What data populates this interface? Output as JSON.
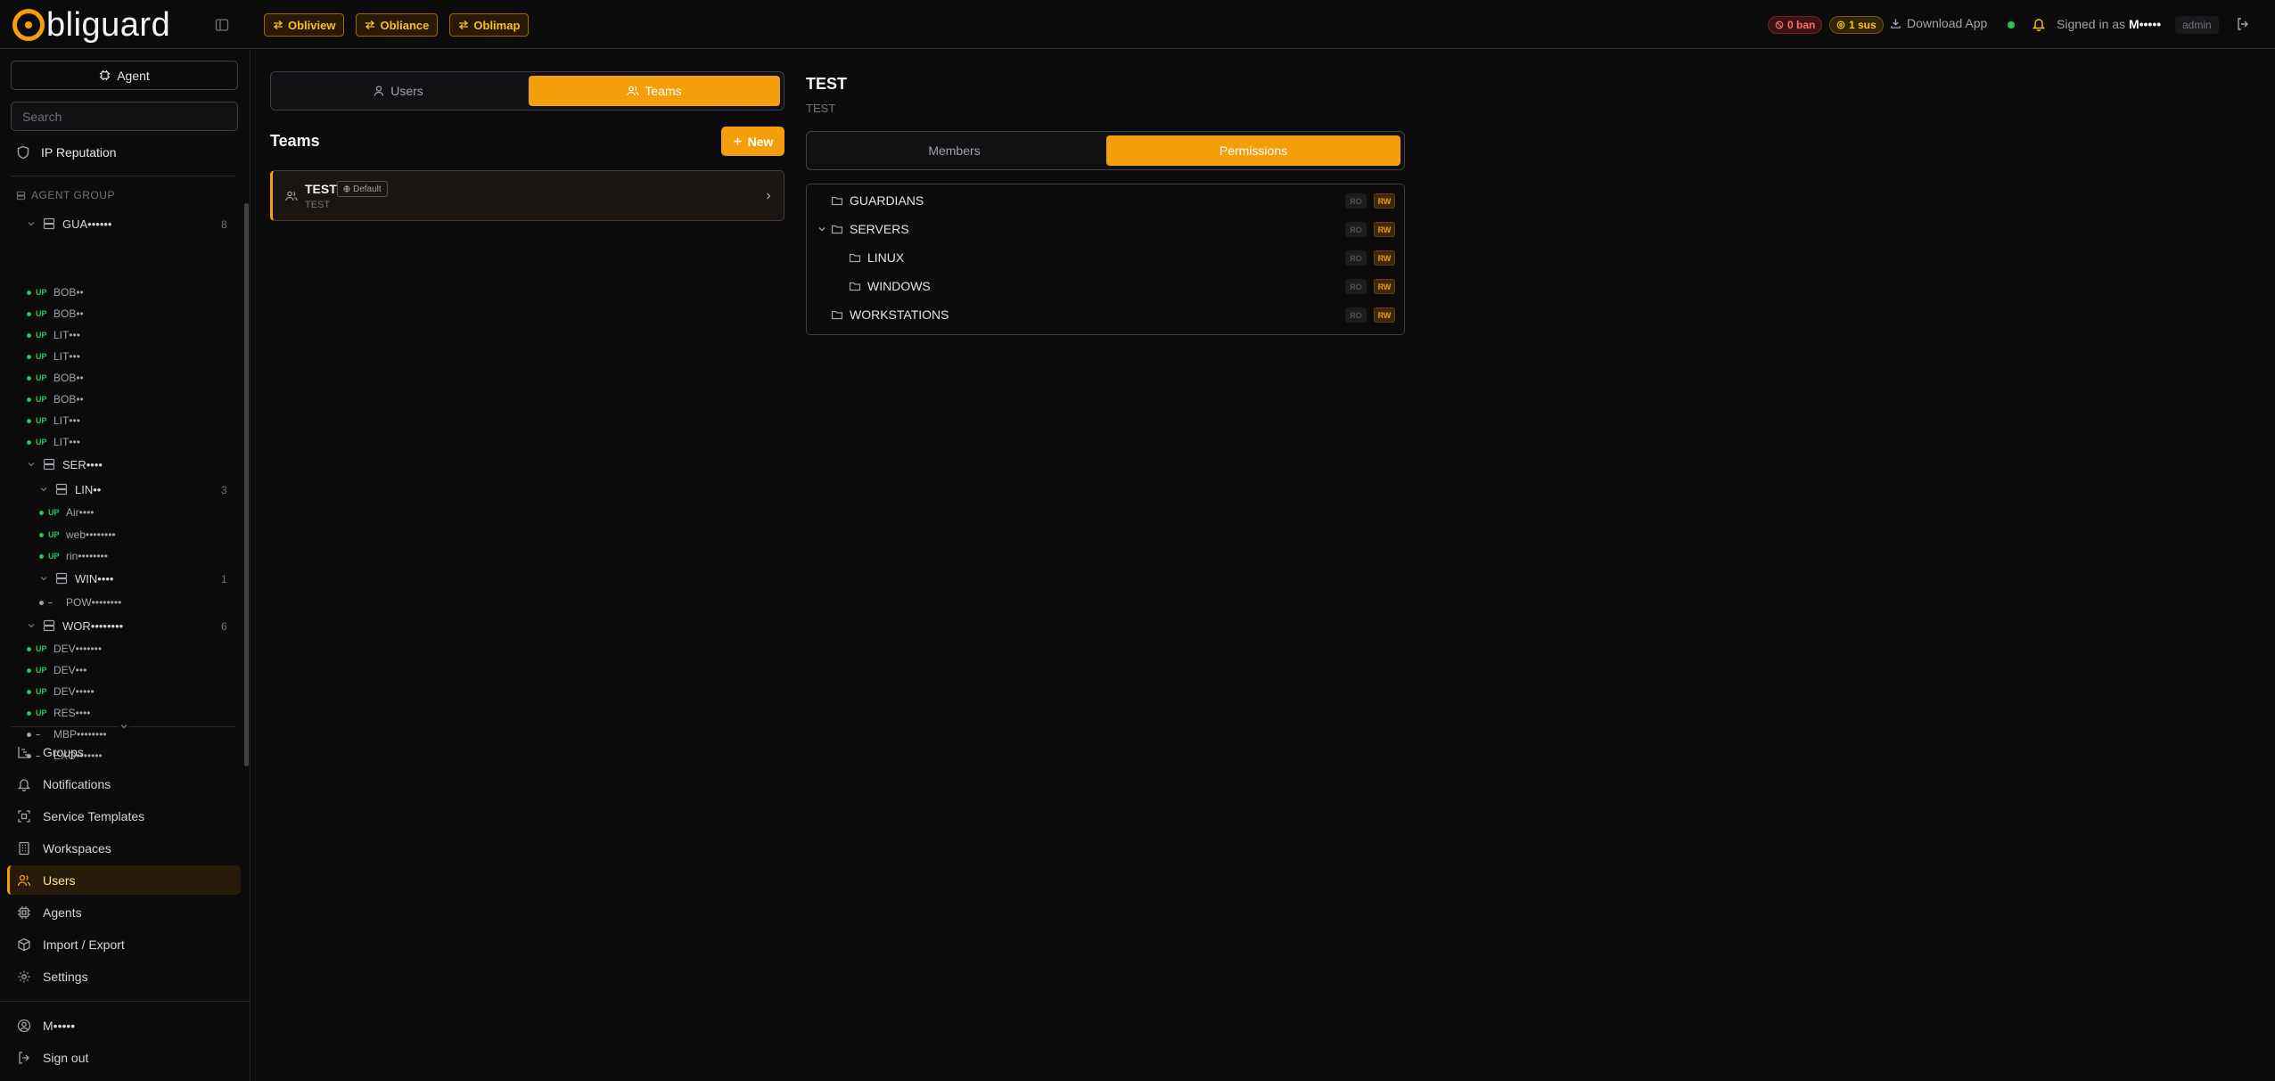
{
  "brand": {
    "logo_letter": "O",
    "logo_text": "bliguard"
  },
  "header": {
    "app_links": [
      {
        "label": "Obliview",
        "icon": "switch-icon"
      },
      {
        "label": "Obliance",
        "icon": "switch-icon"
      },
      {
        "label": "Oblimap",
        "icon": "switch-icon"
      }
    ],
    "ban_badge": "0 ban",
    "sus_badge": "1 sus",
    "download_label": "Download App",
    "signed_in_prefix": "Signed in as",
    "username": "M•••••",
    "role": "admin",
    "colors": {
      "accent": "#f59e0b",
      "online": "#22c55e",
      "ban": "#f87171",
      "sus": "#facc15"
    }
  },
  "sidebar": {
    "agent_button": "Agent",
    "search_placeholder": "Search",
    "ip_reputation": "IP Reputation",
    "agent_group_heading": "AGENT GROUP",
    "tree": {
      "guardians": {
        "name": "GUA••••••",
        "count": "8"
      },
      "guardian_agents": [
        {
          "status": "UP",
          "name": "BOB••"
        },
        {
          "status": "UP",
          "name": "BOB••"
        },
        {
          "status": "UP",
          "name": "LIT•••"
        },
        {
          "status": "UP",
          "name": "LIT•••"
        },
        {
          "status": "UP",
          "name": "BOB••"
        },
        {
          "status": "UP",
          "name": "BOB••"
        },
        {
          "status": "UP",
          "name": "LIT•••"
        },
        {
          "status": "UP",
          "name": "LIT•••"
        }
      ],
      "servers": {
        "name": "SER••••"
      },
      "linux": {
        "name": "LIN••",
        "count": "3"
      },
      "linux_agents": [
        {
          "status": "UP",
          "name": "Air••••"
        },
        {
          "status": "UP",
          "name": "web••••••••"
        },
        {
          "status": "UP",
          "name": "rin••••••••"
        }
      ],
      "windows": {
        "name": "WIN••••",
        "count": "1"
      },
      "windows_agents": [
        {
          "status": "–",
          "name": "POW••••••••"
        }
      ],
      "workstations": {
        "name": "WOR••••••••",
        "count": "6"
      },
      "workstation_agents": [
        {
          "status": "UP",
          "name": "DEV•••••••"
        },
        {
          "status": "UP",
          "name": "DEV•••"
        },
        {
          "status": "UP",
          "name": "DEV•••••"
        },
        {
          "status": "UP",
          "name": "RES••••"
        },
        {
          "status": "–",
          "name": "MBP••••••••"
        },
        {
          "status": "–",
          "name": "EXO•••••••"
        }
      ]
    },
    "nav": [
      {
        "label": "Groups",
        "icon": "groups-icon"
      },
      {
        "label": "Notifications",
        "icon": "bell-icon"
      },
      {
        "label": "Service Templates",
        "icon": "template-icon"
      },
      {
        "label": "Workspaces",
        "icon": "building-icon"
      },
      {
        "label": "Users",
        "icon": "users-icon"
      },
      {
        "label": "Agents",
        "icon": "cpu-icon"
      },
      {
        "label": "Import / Export",
        "icon": "package-icon"
      },
      {
        "label": "Settings",
        "icon": "gear-icon"
      }
    ],
    "footer": {
      "user": "M•••••",
      "sign_out": "Sign out"
    }
  },
  "left_panel": {
    "tabs": [
      {
        "label": "Users"
      },
      {
        "label": "Teams"
      }
    ],
    "active_tab": "Teams",
    "section_title": "Teams",
    "new_button": "New",
    "teams": [
      {
        "name": "TEST",
        "badge": "Default",
        "description": "TEST"
      }
    ]
  },
  "detail": {
    "title": "TEST",
    "subtitle": "TEST",
    "tabs": [
      {
        "label": "Members"
      },
      {
        "label": "Permissions"
      }
    ],
    "active_tab": "Permissions",
    "ro_label": "RO",
    "rw_label": "RW",
    "permissions": [
      {
        "name": "GUARDIANS"
      },
      {
        "name": "SERVERS"
      },
      {
        "name": "LINUX"
      },
      {
        "name": "WINDOWS"
      },
      {
        "name": "WORKSTATIONS"
      }
    ]
  }
}
